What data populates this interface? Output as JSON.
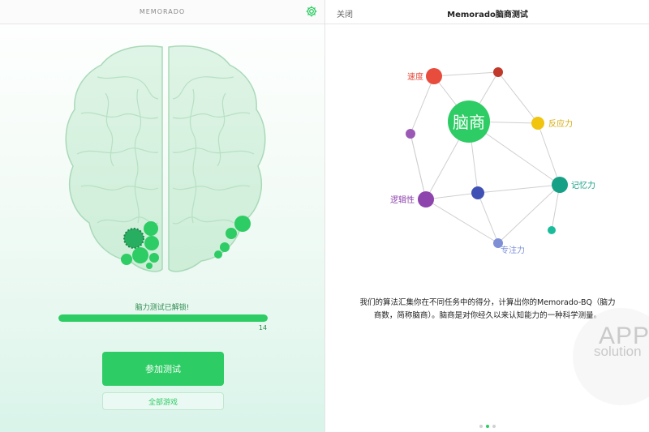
{
  "left_panel": {
    "app_title": "MEMORADO",
    "unlock_text": "脑力测试已解锁!",
    "progress_value": 14,
    "progress_fraction": 1.0,
    "join_button": "参加测试",
    "all_games_button": "全部游戏"
  },
  "right_panel": {
    "close_label": "关闭",
    "title": "Memorado脑商测试",
    "center_node": "脑商",
    "labels": {
      "speed": "速度",
      "reaction": "反应力",
      "memory": "记忆力",
      "logic": "逻辑性",
      "focus": "专注力"
    },
    "description": "我们的算法汇集你在不同任务中的得分，计算出你的Memorado-BQ（脑力商数，简称脑商）。脑商是对你经久以来认知能力的一种科学测量。",
    "page_dots": [
      false,
      true,
      false
    ]
  },
  "watermark": {
    "line1": "APP",
    "line2": "solution"
  },
  "colors": {
    "accent_green": "#2ecc64",
    "speed": "#e74c3c",
    "reaction": "#f1c40f",
    "memory": "#16a085",
    "logic": "#8e44ad",
    "focus": "#7f8fd6",
    "dark_red": "#c0392b",
    "navy": "#3f51b5"
  },
  "icons": {
    "settings": "gear-icon"
  }
}
